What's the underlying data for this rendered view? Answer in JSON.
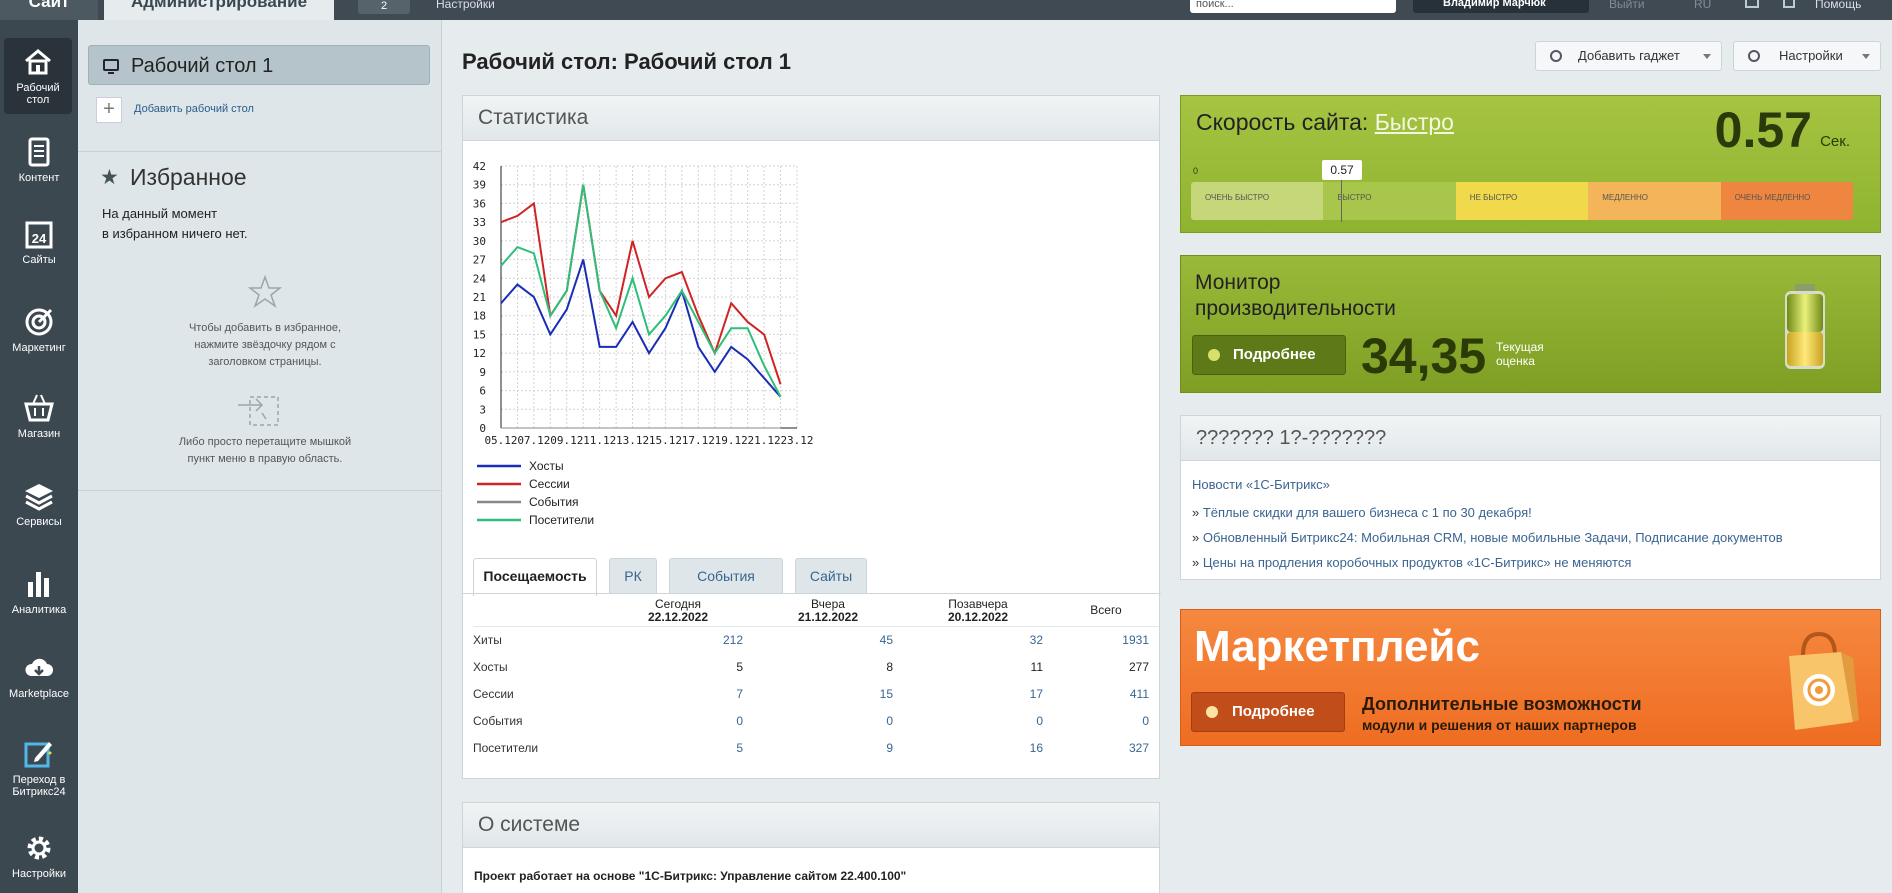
{
  "topbar": {
    "site_tab": "Сайт",
    "admin_tab": "Администрирование",
    "counter": "2",
    "settings": "Настройки",
    "search_placeholder": "поиск...",
    "user": "Владимир Марчюк",
    "exit": "Выйти",
    "lang": "RU",
    "help": "Помощь"
  },
  "leftnav": [
    {
      "label": "Рабочий стол",
      "icon": "home-icon"
    },
    {
      "label": "Контент",
      "icon": "document-icon"
    },
    {
      "label": "Сайты",
      "icon": "calendar-24-icon"
    },
    {
      "label": "Маркетинг",
      "icon": "target-icon"
    },
    {
      "label": "Магазин",
      "icon": "basket-icon"
    },
    {
      "label": "Сервисы",
      "icon": "layers-icon"
    },
    {
      "label": "Аналитика",
      "icon": "bar-chart-icon"
    },
    {
      "label": "Marketplace",
      "icon": "cloud-download-icon"
    },
    {
      "label": "Переход в Битрикс24",
      "icon": "pencil-icon"
    },
    {
      "label": "Настройки",
      "icon": "gear-icon"
    }
  ],
  "leftpanel": {
    "desktop_title": "Рабочий стол 1",
    "add_desktop": "Добавить рабочий стол",
    "favorites_title": "Избранное",
    "fav_empty_1": "На данный момент",
    "fav_empty_2": "в избранном ничего нет.",
    "hint1": "Чтобы добавить в избранное, нажмите звёздочку рядом с заголовком страницы.",
    "hint2": "Либо просто перетащите мышкой пункт меню в правую область."
  },
  "header": {
    "title": "Рабочий стол: Рабочий стол 1",
    "add_gadget": "Добавить гаджет",
    "settings": "Настройки"
  },
  "stats": {
    "title": "Статистика",
    "tabs": [
      "Посещаемость",
      "РК",
      "События",
      "Сайты"
    ],
    "columns": [
      {
        "label": "Сегодня",
        "date": "22.12.2022"
      },
      {
        "label": "Вчера",
        "date": "21.12.2022"
      },
      {
        "label": "Позавчера",
        "date": "20.12.2022"
      },
      {
        "label": "Всего",
        "date": ""
      }
    ],
    "rows": [
      {
        "label": "Хиты",
        "values": [
          "212",
          "45",
          "32",
          "1931"
        ]
      },
      {
        "label": "Хосты",
        "values": [
          "5",
          "8",
          "11",
          "277"
        ]
      },
      {
        "label": "Сессии",
        "values": [
          "7",
          "15",
          "17",
          "411"
        ]
      },
      {
        "label": "События",
        "values": [
          "0",
          "0",
          "0",
          "0"
        ]
      },
      {
        "label": "Посетители",
        "values": [
          "5",
          "9",
          "16",
          "327"
        ]
      }
    ]
  },
  "chart_data": {
    "type": "line",
    "x": [
      "05.12",
      "06.12",
      "07.12",
      "08.12",
      "09.12",
      "10.12",
      "11.12",
      "12.12",
      "13.12",
      "14.12",
      "15.12",
      "16.12",
      "17.12",
      "18.12",
      "19.12",
      "20.12",
      "21.12",
      "22.12",
      "23.12"
    ],
    "x_tick_labels": [
      "05.12",
      "07.12",
      "09.12",
      "11.12",
      "13.12",
      "15.12",
      "17.12",
      "19.12",
      "21.12",
      "23.12"
    ],
    "ylim": [
      0,
      42
    ],
    "y_ticks": [
      0,
      3,
      6,
      9,
      12,
      15,
      18,
      21,
      24,
      27,
      30,
      33,
      36,
      39,
      42
    ],
    "grid": true,
    "legend_position": "bottom-left",
    "series": [
      {
        "name": "Хосты",
        "color": "#1a2db5",
        "values": [
          20,
          23,
          21,
          15,
          19,
          27,
          13,
          13,
          17,
          12,
          16,
          22,
          13,
          9,
          13,
          11,
          8,
          5
        ]
      },
      {
        "name": "Сессии",
        "color": "#d02323",
        "values": [
          33,
          34,
          36,
          18,
          22,
          39,
          22,
          18,
          30,
          21,
          24,
          25,
          18,
          12,
          20,
          17,
          15,
          7
        ]
      },
      {
        "name": "События",
        "color": "#888888",
        "values": [
          0,
          0,
          0,
          0,
          0,
          0,
          0,
          0,
          0,
          0,
          0,
          0,
          0,
          0,
          0,
          0,
          0,
          0
        ]
      },
      {
        "name": "Посетители",
        "color": "#2fbf7a",
        "values": [
          26,
          29,
          28,
          18,
          22,
          39,
          22,
          16,
          24,
          15,
          18,
          22,
          17,
          12,
          16,
          16,
          10,
          5
        ]
      }
    ]
  },
  "about": {
    "title": "О системе",
    "text": "Проект работает на основе \"1С-Битрикс: Управление сайтом 22.400.100\""
  },
  "speed": {
    "label": "Скорость сайта:",
    "value_text": "Быстро",
    "number": "0.57",
    "unit": "Сек.",
    "zero": "0",
    "marker": "0.57",
    "marker_fraction": 0.2,
    "scale": [
      {
        "label": "ОЧЕНЬ БЫСТРО",
        "color": "#c6d77a"
      },
      {
        "label": "БЫСТРО",
        "color": "#a8c54c"
      },
      {
        "label": "НЕ БЫСТРО",
        "color": "#f0d94a"
      },
      {
        "label": "МЕДЛЕННО",
        "color": "#f3b45a"
      },
      {
        "label": "ОЧЕНЬ МЕДЛЕННО",
        "color": "#ef8640"
      }
    ]
  },
  "monitor": {
    "title_1": "Монитор",
    "title_2": "производительности",
    "button": "Подробнее",
    "score": "34,35",
    "score_label_1": "Текущая",
    "score_label_2": "оценка"
  },
  "news": {
    "title": "??????? 1?-???????",
    "source": "Новости «1С-Битрикс»",
    "items": [
      "Тёплые скидки для вашего бизнеса с 1 по 30 декабря!",
      "Обновленный Битрикс24: Мобильная CRM, новые мобильные Задачи, Подписание документов",
      "Цены на продления коробочных продуктов «1С-Битрикс» не меняются"
    ]
  },
  "market": {
    "title": "Маркетплейс",
    "button": "Подробнее",
    "desc1": "Дополнительные возможности",
    "desc2": "модули и решения от наших партнеров"
  }
}
